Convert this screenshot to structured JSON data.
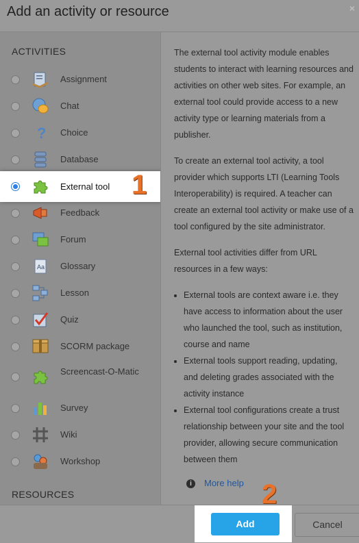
{
  "dialog": {
    "title": "Add an activity or resource",
    "close_glyph": "×"
  },
  "sections": {
    "activities": "ACTIVITIES",
    "resources": "RESOURCES"
  },
  "activities": [
    {
      "label": "Assignment",
      "icon": "assignment-icon"
    },
    {
      "label": "Chat",
      "icon": "chat-icon"
    },
    {
      "label": "Choice",
      "icon": "choice-icon"
    },
    {
      "label": "Database",
      "icon": "database-icon"
    },
    {
      "label": "External tool",
      "icon": "puzzle-icon",
      "selected": true
    },
    {
      "label": "Feedback",
      "icon": "megaphone-icon"
    },
    {
      "label": "Forum",
      "icon": "forum-icon"
    },
    {
      "label": "Glossary",
      "icon": "glossary-icon"
    },
    {
      "label": "Lesson",
      "icon": "lesson-icon"
    },
    {
      "label": "Quiz",
      "icon": "quiz-icon"
    },
    {
      "label": "SCORM package",
      "icon": "scorm-icon"
    },
    {
      "label": "Screencast-O-Matic",
      "icon": "puzzle-icon"
    },
    {
      "label": "Survey",
      "icon": "survey-icon"
    },
    {
      "label": "Wiki",
      "icon": "wiki-icon"
    },
    {
      "label": "Workshop",
      "icon": "workshop-icon"
    }
  ],
  "description": {
    "p1": "The external tool activity module enables students to interact with learning resources and activities on other web sites. For example, an external tool could provide access to a new activity type or learning materials from a publisher.",
    "p2": "To create an external tool activity, a tool provider which supports LTI (Learning Tools Interoperability) is required. A teacher can create an external tool activity or make use of a tool configured by the site administrator.",
    "p3": "External tool activities differ from URL resources in a few ways:",
    "bullets": [
      "External tools are context aware i.e. they have access to information about the user who launched the tool, such as institution, course and name",
      "External tools support reading, updating, and deleting grades associated with the activity instance",
      "External tool configurations create a trust relationship between your site and the tool provider, allowing secure communication between them"
    ],
    "help_label": "More help",
    "help_glyph": "i"
  },
  "footer": {
    "add_label": "Add",
    "cancel_label": "Cancel"
  },
  "annotations": {
    "step1": "1",
    "step2": "2"
  },
  "colors": {
    "accent": "#27a3e8",
    "step_number": "#e8722a",
    "radio_selected": "#2f80e8"
  }
}
